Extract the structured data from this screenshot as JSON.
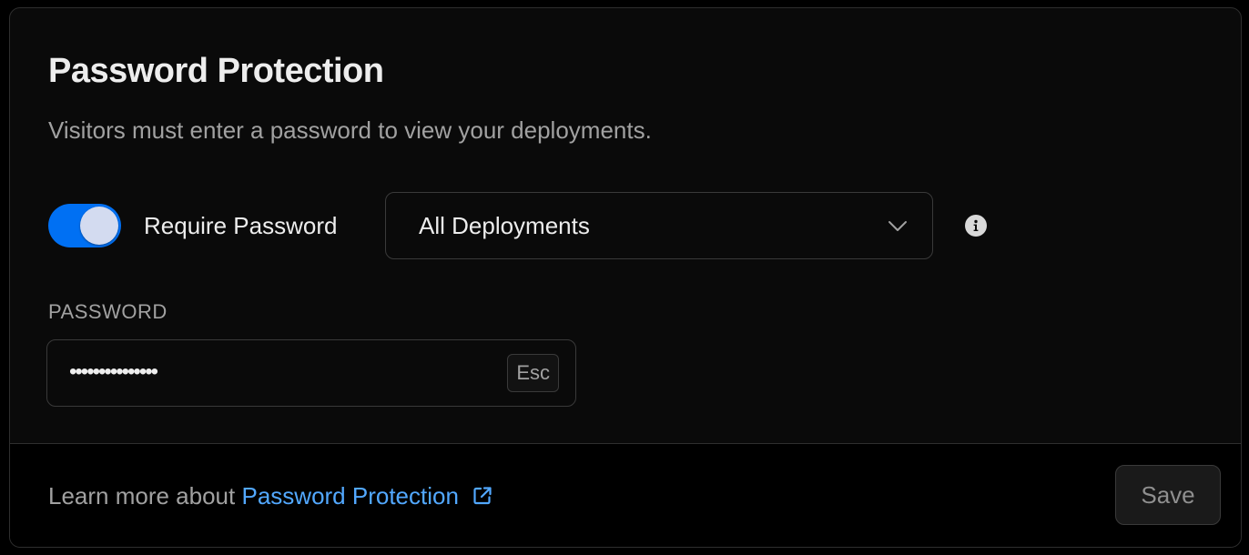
{
  "header": {
    "title": "Password Protection",
    "subtitle": "Visitors must enter a password to view your deployments."
  },
  "require_password": {
    "enabled": true,
    "label": "Require Password"
  },
  "scope_select": {
    "value": "All Deployments",
    "icon": "chevron-down-icon"
  },
  "info": {
    "icon": "info-icon"
  },
  "password": {
    "label": "PASSWORD",
    "masked_value": "•••••••••••••••",
    "escape_key": "Esc"
  },
  "footer": {
    "prefix": "Learn more about",
    "link_text": "Password Protection",
    "link_icon": "external-link-icon",
    "save_label": "Save"
  },
  "colors": {
    "accent": "#0070f3",
    "link": "#52a8ff",
    "background": "#0a0a0a",
    "border": "#2e2e2e"
  }
}
